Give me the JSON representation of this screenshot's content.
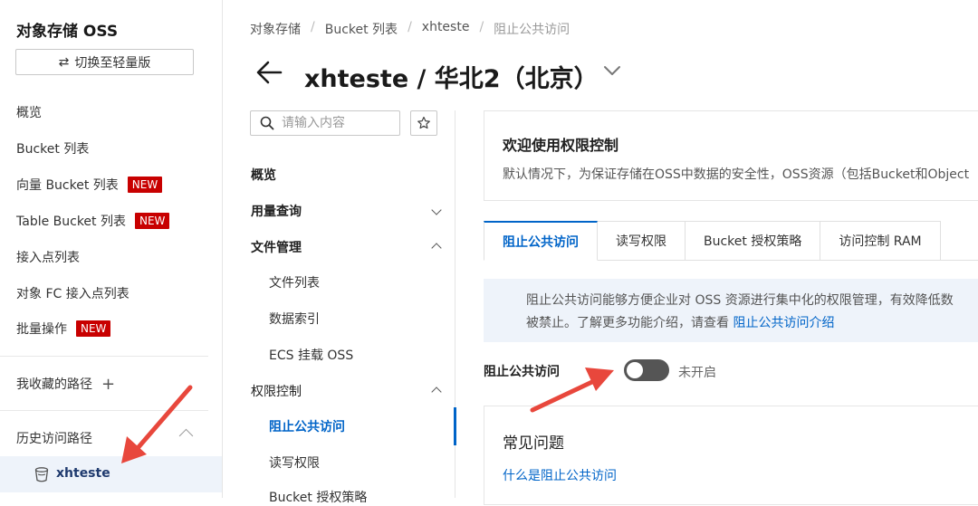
{
  "sidebar": {
    "title": "对象存储 OSS",
    "switch_button": "切换至轻量版",
    "items": [
      {
        "label": "概览",
        "badge": ""
      },
      {
        "label": "Bucket 列表",
        "badge": ""
      },
      {
        "label": "向量 Bucket 列表",
        "badge": "NEW"
      },
      {
        "label": "Table Bucket 列表",
        "badge": "NEW"
      },
      {
        "label": "接入点列表",
        "badge": ""
      },
      {
        "label": "对象 FC 接入点列表",
        "badge": ""
      },
      {
        "label": "批量操作",
        "badge": "NEW"
      }
    ],
    "favorites_label": "我收藏的路径",
    "history_label": "历史访问路径",
    "history_items": [
      "xhteste"
    ]
  },
  "header": {
    "breadcrumb": [
      "对象存储",
      "Bucket 列表",
      "xhteste",
      "阻止公共访问"
    ],
    "title": "xhteste / 华北2（北京）"
  },
  "subnav": {
    "search_placeholder": "请输入内容",
    "items": [
      {
        "label": "概览"
      },
      {
        "label": "用量查询"
      },
      {
        "label": "文件管理"
      },
      {
        "label": "文件列表"
      },
      {
        "label": "数据索引"
      },
      {
        "label": "ECS 挂载 OSS"
      },
      {
        "label": "权限控制"
      },
      {
        "label": "阻止公共访问"
      },
      {
        "label": "读写权限"
      },
      {
        "label": "Bucket 授权策略"
      }
    ]
  },
  "main": {
    "welcome_title": "欢迎使用权限控制",
    "welcome_desc": "默认情况下，为保证存储在OSS中数据的安全性，OSS资源（包括Bucket和Object",
    "tabs": [
      "阻止公共访问",
      "读写权限",
      "Bucket 授权策略",
      "访问控制 RAM"
    ],
    "info_line1": "阻止公共访问能够方便企业对 OSS 资源进行集中化的权限管理，有效降低数",
    "info_line2_prefix": "被禁止。了解更多功能介绍，请查看 ",
    "info_link": "阻止公共访问介绍",
    "toggle_label": "阻止公共访问",
    "toggle_status": "未开启",
    "toggle_on": false,
    "faq_title": "常见问题",
    "faq_link": "什么是阻止公共访问"
  },
  "colors": {
    "accent": "#0064c8",
    "badge": "#c80000",
    "annotation": "#e8473c"
  }
}
